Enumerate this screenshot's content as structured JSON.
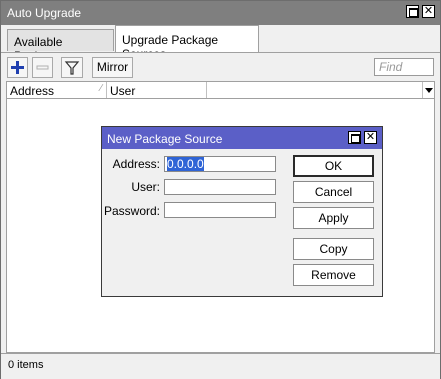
{
  "window": {
    "title": "Auto Upgrade"
  },
  "tabs": [
    {
      "label": "Available Packages",
      "active": false
    },
    {
      "label": "Upgrade Package Sources",
      "active": true
    }
  ],
  "toolbar": {
    "add_icon": "plus-icon",
    "remove_icon": "minus-icon",
    "filter_icon": "filter-icon",
    "mirror_label": "Mirror",
    "find_placeholder": "Find"
  },
  "table": {
    "columns": [
      "Address",
      "User"
    ],
    "rows": []
  },
  "status": {
    "items_text": "0 items"
  },
  "dialog": {
    "title": "New Package Source",
    "fields": {
      "address_label": "Address:",
      "address_value": "0.0.0.0",
      "user_label": "User:",
      "user_value": "",
      "password_label": "Password:",
      "password_value": ""
    },
    "buttons": {
      "ok": "OK",
      "cancel": "Cancel",
      "apply": "Apply",
      "copy": "Copy",
      "remove": "Remove"
    }
  },
  "colors": {
    "titlebar": "#7f7f7f",
    "dialog_titlebar": "#5b5fc7",
    "add_icon": "#1f3fb0",
    "selection": "#2f64d6"
  }
}
